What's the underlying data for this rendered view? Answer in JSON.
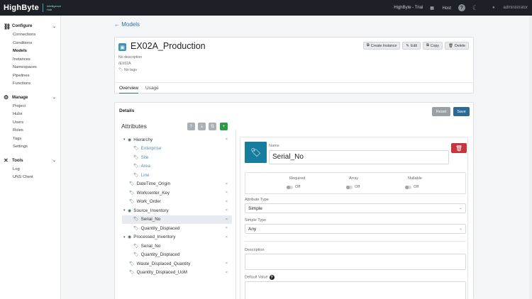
{
  "topbar": {
    "brand": "HighByte",
    "brand_sub_1": "Intelligence",
    "brand_sub_2": "Hub",
    "instance": "HighByte - Trial",
    "host": "Host",
    "user": "administrator"
  },
  "sidebar": {
    "sections": [
      {
        "label": "Configure",
        "items": [
          "Connections",
          "Conditions",
          "Models",
          "Instances",
          "Namespaces",
          "Pipelines",
          "Functions"
        ]
      },
      {
        "label": "Manage",
        "items": [
          "Project",
          "Hubs",
          "Users",
          "Roles",
          "Tags",
          "Settings"
        ]
      },
      {
        "label": "Tools",
        "items": [
          "Log",
          "UNS Client"
        ]
      }
    ],
    "active": "Models"
  },
  "back_link": "Models",
  "model": {
    "title": "EX02A_Production",
    "description": "No description",
    "path": "/EX02A",
    "tags": "No tags"
  },
  "header_buttons": {
    "create": "Create Instance",
    "edit": "Edit",
    "copy": "Copy",
    "delete": "Delete"
  },
  "tabs": [
    "Overview",
    "Usage"
  ],
  "details": {
    "title": "Details",
    "reset": "Reset",
    "save": "Save",
    "attributes_heading": "Attributes"
  },
  "tree": [
    {
      "label": "Hierarchy",
      "level": 0,
      "expand": "▾",
      "icon": "model"
    },
    {
      "label": "Enterprise",
      "level": 1,
      "icon": "tag"
    },
    {
      "label": "Site",
      "level": 1,
      "icon": "tag"
    },
    {
      "label": "Area",
      "level": 1,
      "icon": "tag"
    },
    {
      "label": "Line",
      "level": 1,
      "icon": "tag"
    },
    {
      "label": "DateTime_Origin",
      "level": 0,
      "icon": "tag"
    },
    {
      "label": "Workcenter_Key",
      "level": 0,
      "icon": "tag"
    },
    {
      "label": "Work_Order",
      "level": 0,
      "icon": "tag"
    },
    {
      "label": "Source_Inventory",
      "level": 0,
      "expand": "▾",
      "icon": "model"
    },
    {
      "label": "Serial_No",
      "level": 1,
      "icon": "tag",
      "selected": true
    },
    {
      "label": "Quantity_Displaced",
      "level": 1,
      "icon": "tag"
    },
    {
      "label": "Processed_Inventory",
      "level": 0,
      "expand": "▾",
      "icon": "model"
    },
    {
      "label": "Serial_No",
      "level": 1,
      "icon": "tag"
    },
    {
      "label": "Quantity_Displaced",
      "level": 1,
      "icon": "tag"
    },
    {
      "label": "Waste_Displaced_Quantity",
      "level": 0,
      "icon": "tag"
    },
    {
      "label": "Quantity_Displaced_UoM",
      "level": 0,
      "icon": "tag"
    }
  ],
  "editor": {
    "name_label": "Name",
    "name_value": "Serial_No",
    "required_label": "Required",
    "required_value": "Off",
    "array_label": "Array",
    "array_value": "Off",
    "nullable_label": "Nullable",
    "nullable_value": "Off",
    "attr_type_label": "Attribute Type",
    "attr_type_value": "Simple",
    "simple_type_label": "Simple Type",
    "simple_type_value": "Any",
    "description_label": "Description",
    "default_value_label": "Default Value"
  }
}
